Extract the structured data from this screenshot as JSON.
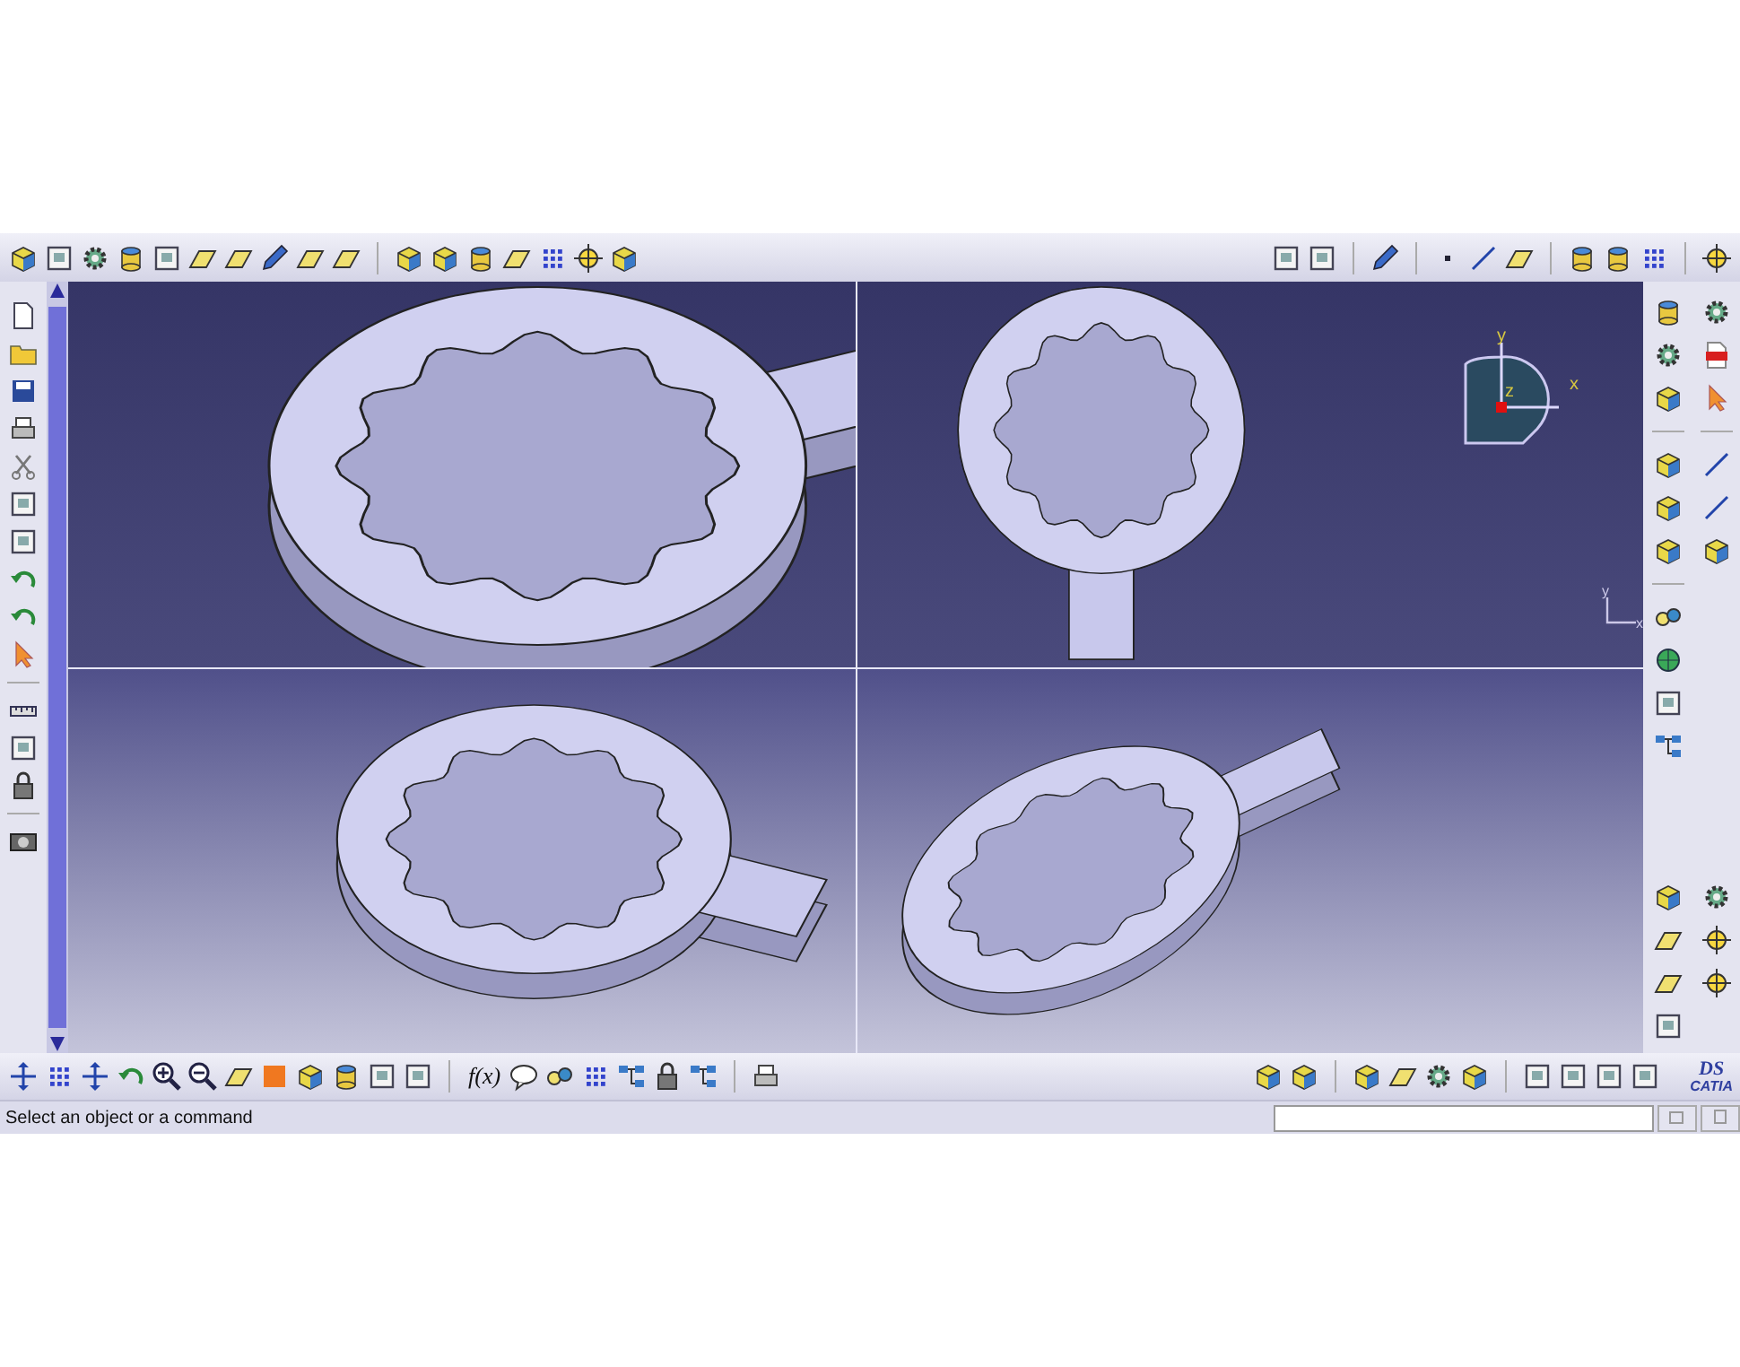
{
  "viewports": [
    {
      "kind": "close"
    },
    {
      "kind": "top"
    },
    {
      "kind": "front"
    },
    {
      "kind": "side"
    }
  ],
  "compass": {
    "y_label": "y",
    "z_label": "z",
    "x_label": "x"
  },
  "axis_triad": {
    "y_label": "y",
    "x_label": "x"
  },
  "formula_icon_label": "f(x)",
  "logo": {
    "mark": "DS",
    "name": "CATIA"
  },
  "status_bar": {
    "message": "Select an object or a command"
  }
}
